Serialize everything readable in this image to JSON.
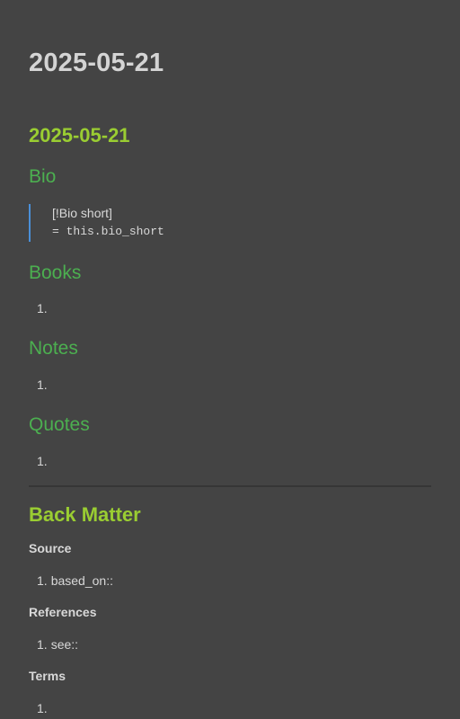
{
  "note": {
    "title": "2025-05-21",
    "heading": "2025-05-21",
    "sections": {
      "bio": {
        "heading": "Bio",
        "callout_label": "[!Bio short]",
        "callout_code": "= this.bio_short"
      },
      "books": {
        "heading": "Books",
        "item_number": "1."
      },
      "notes": {
        "heading": "Notes",
        "item_number": "1."
      },
      "quotes": {
        "heading": "Quotes",
        "item_number": "1."
      }
    },
    "back_matter": {
      "heading": "Back Matter",
      "source": {
        "heading": "Source",
        "item_number": "1.",
        "item_text": "based_on::"
      },
      "references": {
        "heading": "References",
        "item_number": "1.",
        "item_text": "see::"
      },
      "terms": {
        "heading": "Terms",
        "item_number": "1."
      }
    }
  },
  "colors": {
    "background": "#444444",
    "h1": "#9acd32",
    "h2": "#4caf50",
    "callout_border": "#4a8fd8",
    "text": "#d8d8d8"
  }
}
